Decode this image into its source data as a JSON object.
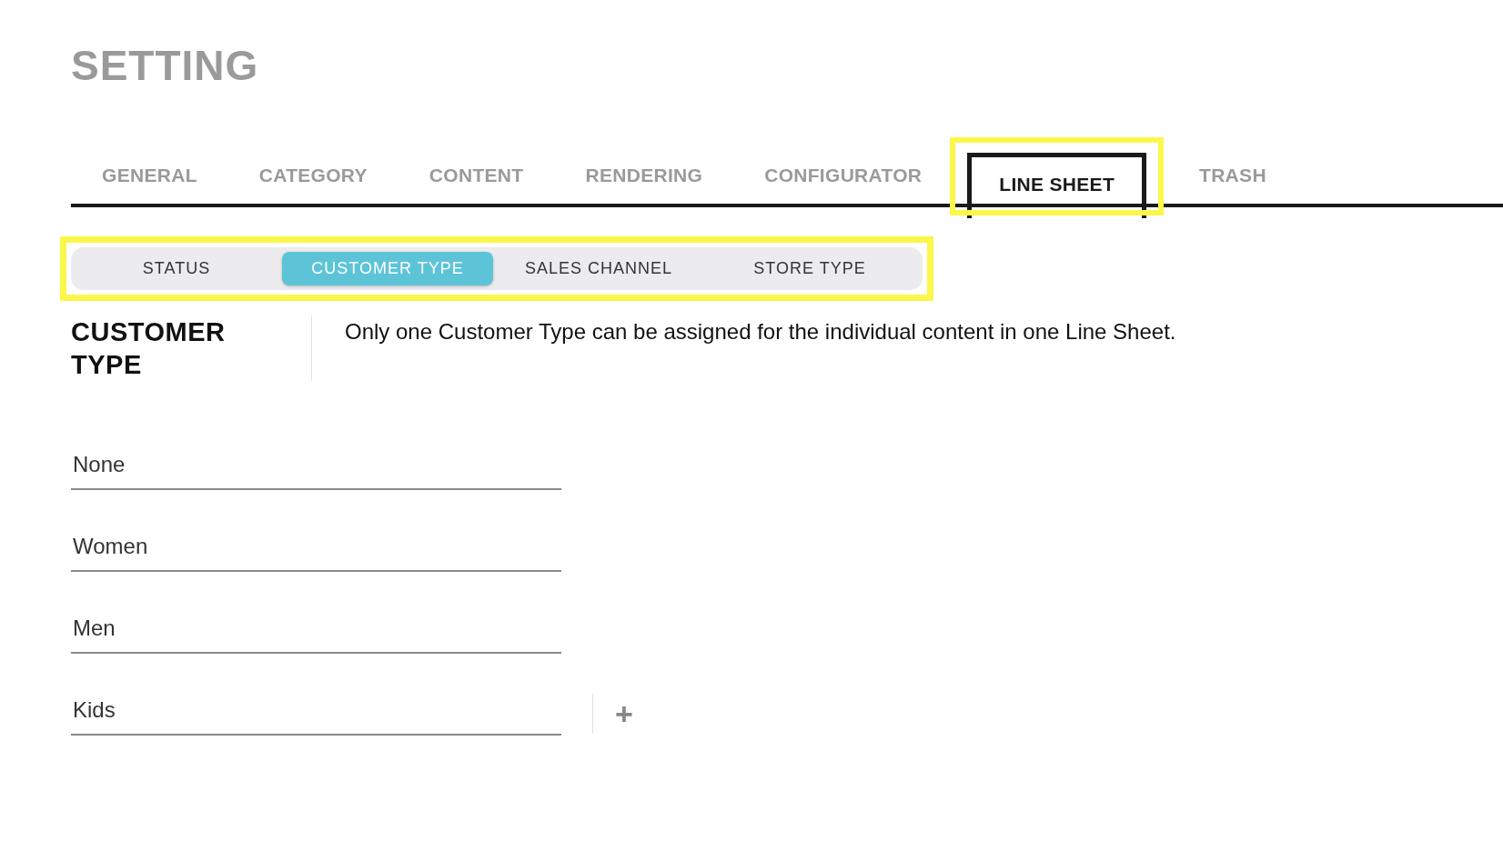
{
  "page_title": "SETTING",
  "tabs": [
    {
      "label": "GENERAL",
      "selected": false,
      "highlighted": false
    },
    {
      "label": "CATEGORY",
      "selected": false,
      "highlighted": false
    },
    {
      "label": "CONTENT",
      "selected": false,
      "highlighted": false
    },
    {
      "label": "RENDERING",
      "selected": false,
      "highlighted": false
    },
    {
      "label": "CONFIGURATOR",
      "selected": false,
      "highlighted": false
    },
    {
      "label": "LINE SHEET",
      "selected": true,
      "highlighted": true
    },
    {
      "label": "TRASH",
      "selected": false,
      "highlighted": false
    }
  ],
  "subtabs": {
    "highlighted": true,
    "items": [
      {
        "label": "STATUS",
        "selected": false
      },
      {
        "label": "CUSTOMER TYPE",
        "selected": true
      },
      {
        "label": "SALES CHANNEL",
        "selected": false
      },
      {
        "label": "STORE TYPE",
        "selected": false
      }
    ]
  },
  "section": {
    "heading": "CUSTOMER TYPE",
    "description": "Only one Customer Type can be assigned for the individual content in one Line Sheet."
  },
  "fields": [
    {
      "value": "None"
    },
    {
      "value": "Women"
    },
    {
      "value": "Men"
    },
    {
      "value": "Kids"
    }
  ],
  "add_button": {
    "label": "+"
  }
}
